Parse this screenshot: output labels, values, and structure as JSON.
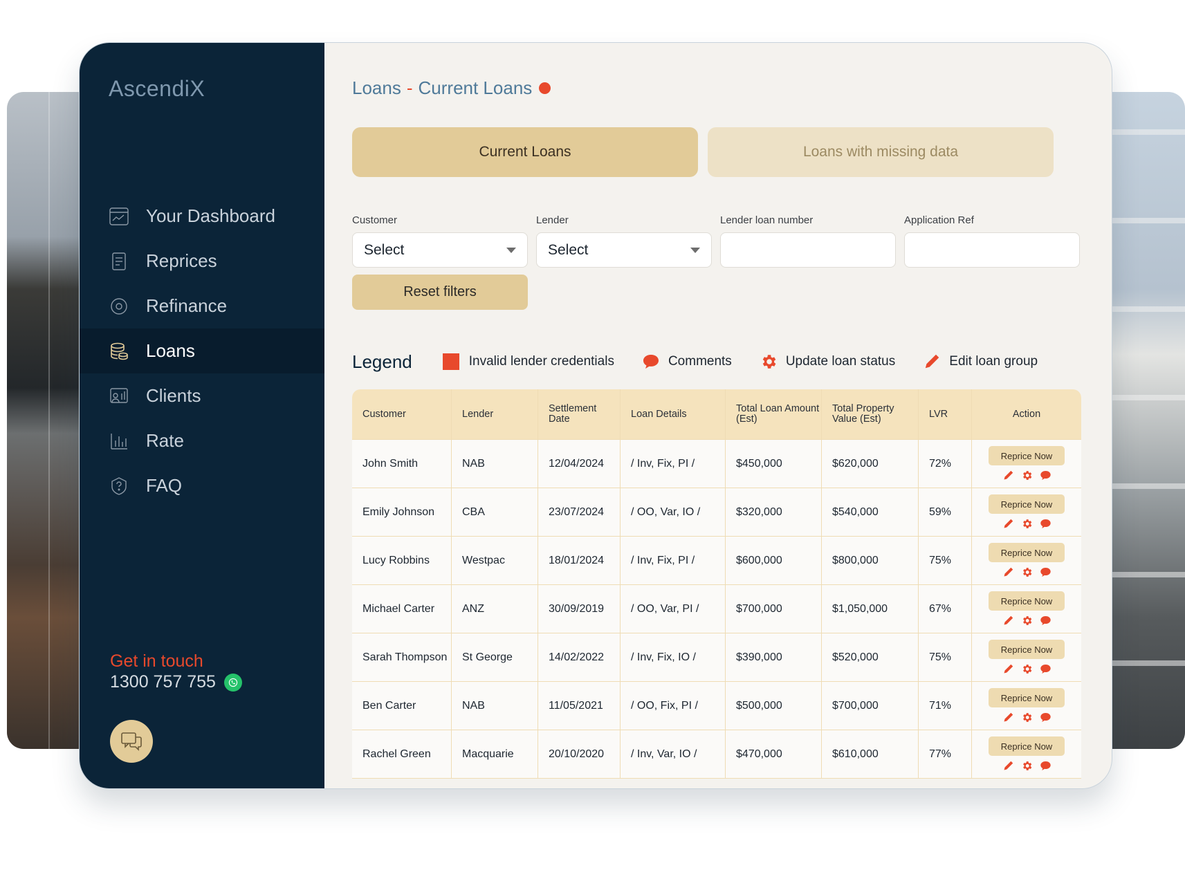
{
  "app": {
    "logo": "AscendiX"
  },
  "sidebar": {
    "items": [
      {
        "label": "Your Dashboard",
        "icon": "dashboard-icon"
      },
      {
        "label": "Reprices",
        "icon": "document-icon"
      },
      {
        "label": "Refinance",
        "icon": "refresh-icon"
      },
      {
        "label": "Loans",
        "icon": "coins-icon",
        "active": true
      },
      {
        "label": "Clients",
        "icon": "clients-icon"
      },
      {
        "label": "Rate",
        "icon": "bar-chart-icon"
      },
      {
        "label": "FAQ",
        "icon": "help-icon"
      }
    ],
    "contact": {
      "label": "Get in touch",
      "phone": "1300 757 755",
      "icon": "whatsapp-icon"
    },
    "chat_icon": "chat-icon"
  },
  "page": {
    "title_part1": "Loans",
    "title_sep": "-",
    "title_part2": "Current Loans",
    "status_color": "#e8492c"
  },
  "tabs": [
    {
      "label": "Current Loans",
      "active": true
    },
    {
      "label": "Loans with missing data",
      "active": false
    }
  ],
  "filters": [
    {
      "label": "Customer",
      "value": "Select",
      "type": "select"
    },
    {
      "label": "Lender",
      "value": "Select",
      "type": "select"
    },
    {
      "label": "Lender loan number",
      "value": "",
      "type": "input"
    },
    {
      "label": "Application Ref",
      "value": "",
      "type": "input"
    }
  ],
  "reset_label": "Reset filters",
  "legend": {
    "title": "Legend",
    "items": [
      {
        "label": "Invalid lender credentials",
        "icon": "red-square-icon"
      },
      {
        "label": "Comments",
        "icon": "comment-icon"
      },
      {
        "label": "Update loan status",
        "icon": "gear-icon"
      },
      {
        "label": "Edit loan group",
        "icon": "pencil-icon"
      }
    ]
  },
  "table": {
    "headers": [
      "Customer",
      "Lender",
      "Settlement Date",
      "Loan Details",
      "Total Loan Amount (Est)",
      "Total Property Value (Est)",
      "LVR",
      "Action"
    ],
    "action_label": "Reprice Now",
    "rows": [
      [
        "John Smith",
        "NAB",
        "12/04/2024",
        "/ Inv, Fix, PI /",
        "$450,000",
        "$620,000",
        "72%"
      ],
      [
        "Emily Johnson",
        "CBA",
        "23/07/2024",
        "/ OO, Var, IO /",
        "$320,000",
        "$540,000",
        "59%"
      ],
      [
        "Lucy Robbins",
        "Westpac",
        "18/01/2024",
        "/ Inv, Fix, PI /",
        "$600,000",
        "$800,000",
        "75%"
      ],
      [
        "Michael Carter",
        "ANZ",
        "30/09/2019",
        "/ OO, Var, PI /",
        "$700,000",
        "$1,050,000",
        "67%"
      ],
      [
        "Sarah Thompson",
        "St George",
        "14/02/2022",
        "/ Inv, Fix, IO /",
        "$390,000",
        "$520,000",
        "75%"
      ],
      [
        "Ben Carter",
        "NAB",
        "11/05/2021",
        "/ OO, Fix, PI /",
        "$500,000",
        "$700,000",
        "71%"
      ],
      [
        "Rachel Green",
        "Macquarie",
        "20/10/2020",
        "/ Inv, Var, IO /",
        "$470,000",
        "$610,000",
        "77%"
      ]
    ]
  }
}
